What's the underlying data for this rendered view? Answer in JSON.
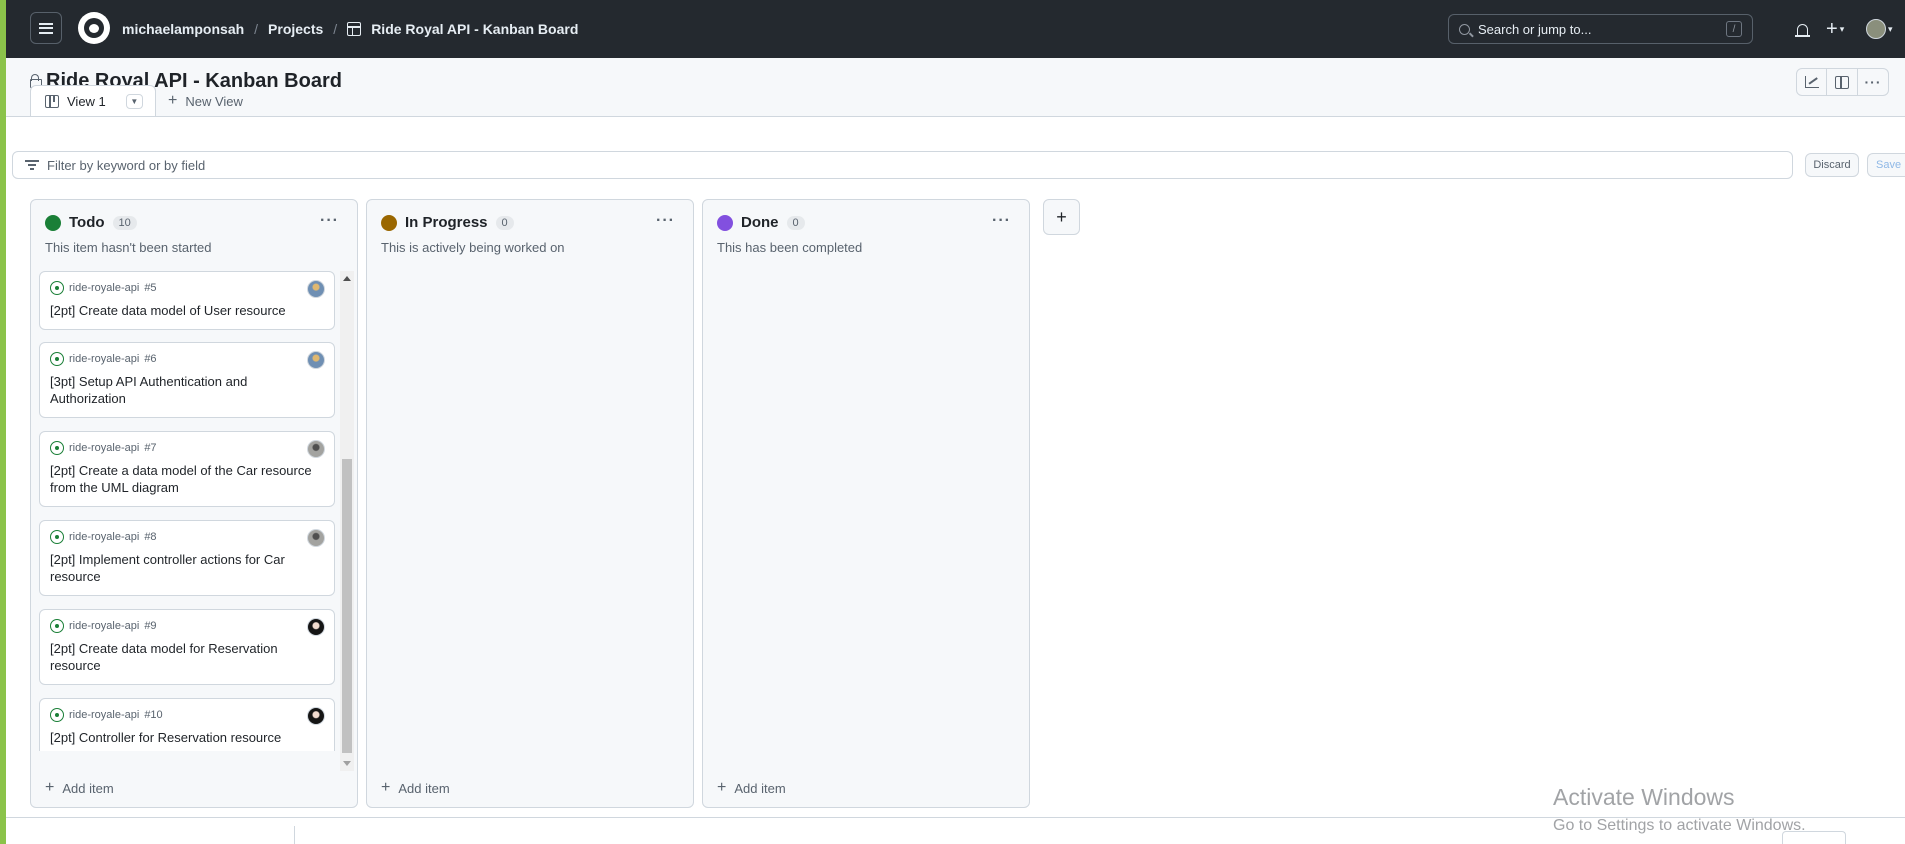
{
  "header": {
    "owner": "michaelamponsah",
    "projects": "Projects",
    "project_name": "Ride Royal API - Kanban Board",
    "search_placeholder": "Search or jump to...",
    "search_shortcut": "/"
  },
  "project": {
    "title": "Ride Royal API - Kanban Board",
    "tab_label": "View 1",
    "new_view_label": "New View",
    "filter_placeholder": "Filter by keyword or by field",
    "discard_label": "Discard",
    "save_label": "Save"
  },
  "columns": [
    {
      "name": "Todo",
      "count": "10",
      "description": "This item hasn't been started",
      "color": "#1a7f37",
      "add_label": "Add item",
      "cards": [
        {
          "repo": "ride-royale-api",
          "number": "#5",
          "title": "[2pt] Create data model of User resource"
        },
        {
          "repo": "ride-royale-api",
          "number": "#6",
          "title": "[3pt] Setup API Authentication and Authorization"
        },
        {
          "repo": "ride-royale-api",
          "number": "#7",
          "title": "[2pt] Create a data model of the Car resource from the UML diagram"
        },
        {
          "repo": "ride-royale-api",
          "number": "#8",
          "title": "[2pt] Implement controller actions for Car resource"
        },
        {
          "repo": "ride-royale-api",
          "number": "#9",
          "title": "[2pt] Create data model for Reservation resource"
        },
        {
          "repo": "ride-royale-api",
          "number": "#10",
          "title": "[2pt] Controller for Reservation resource"
        }
      ]
    },
    {
      "name": "In Progress",
      "count": "0",
      "description": "This is actively being worked on",
      "color": "#9a6700",
      "add_label": "Add item",
      "cards": []
    },
    {
      "name": "Done",
      "count": "0",
      "description": "This has been completed",
      "color": "#8250df",
      "add_label": "Add item",
      "cards": []
    }
  ],
  "watermark": {
    "line1": "Activate Windows",
    "line2": "Go to Settings to activate Windows."
  }
}
